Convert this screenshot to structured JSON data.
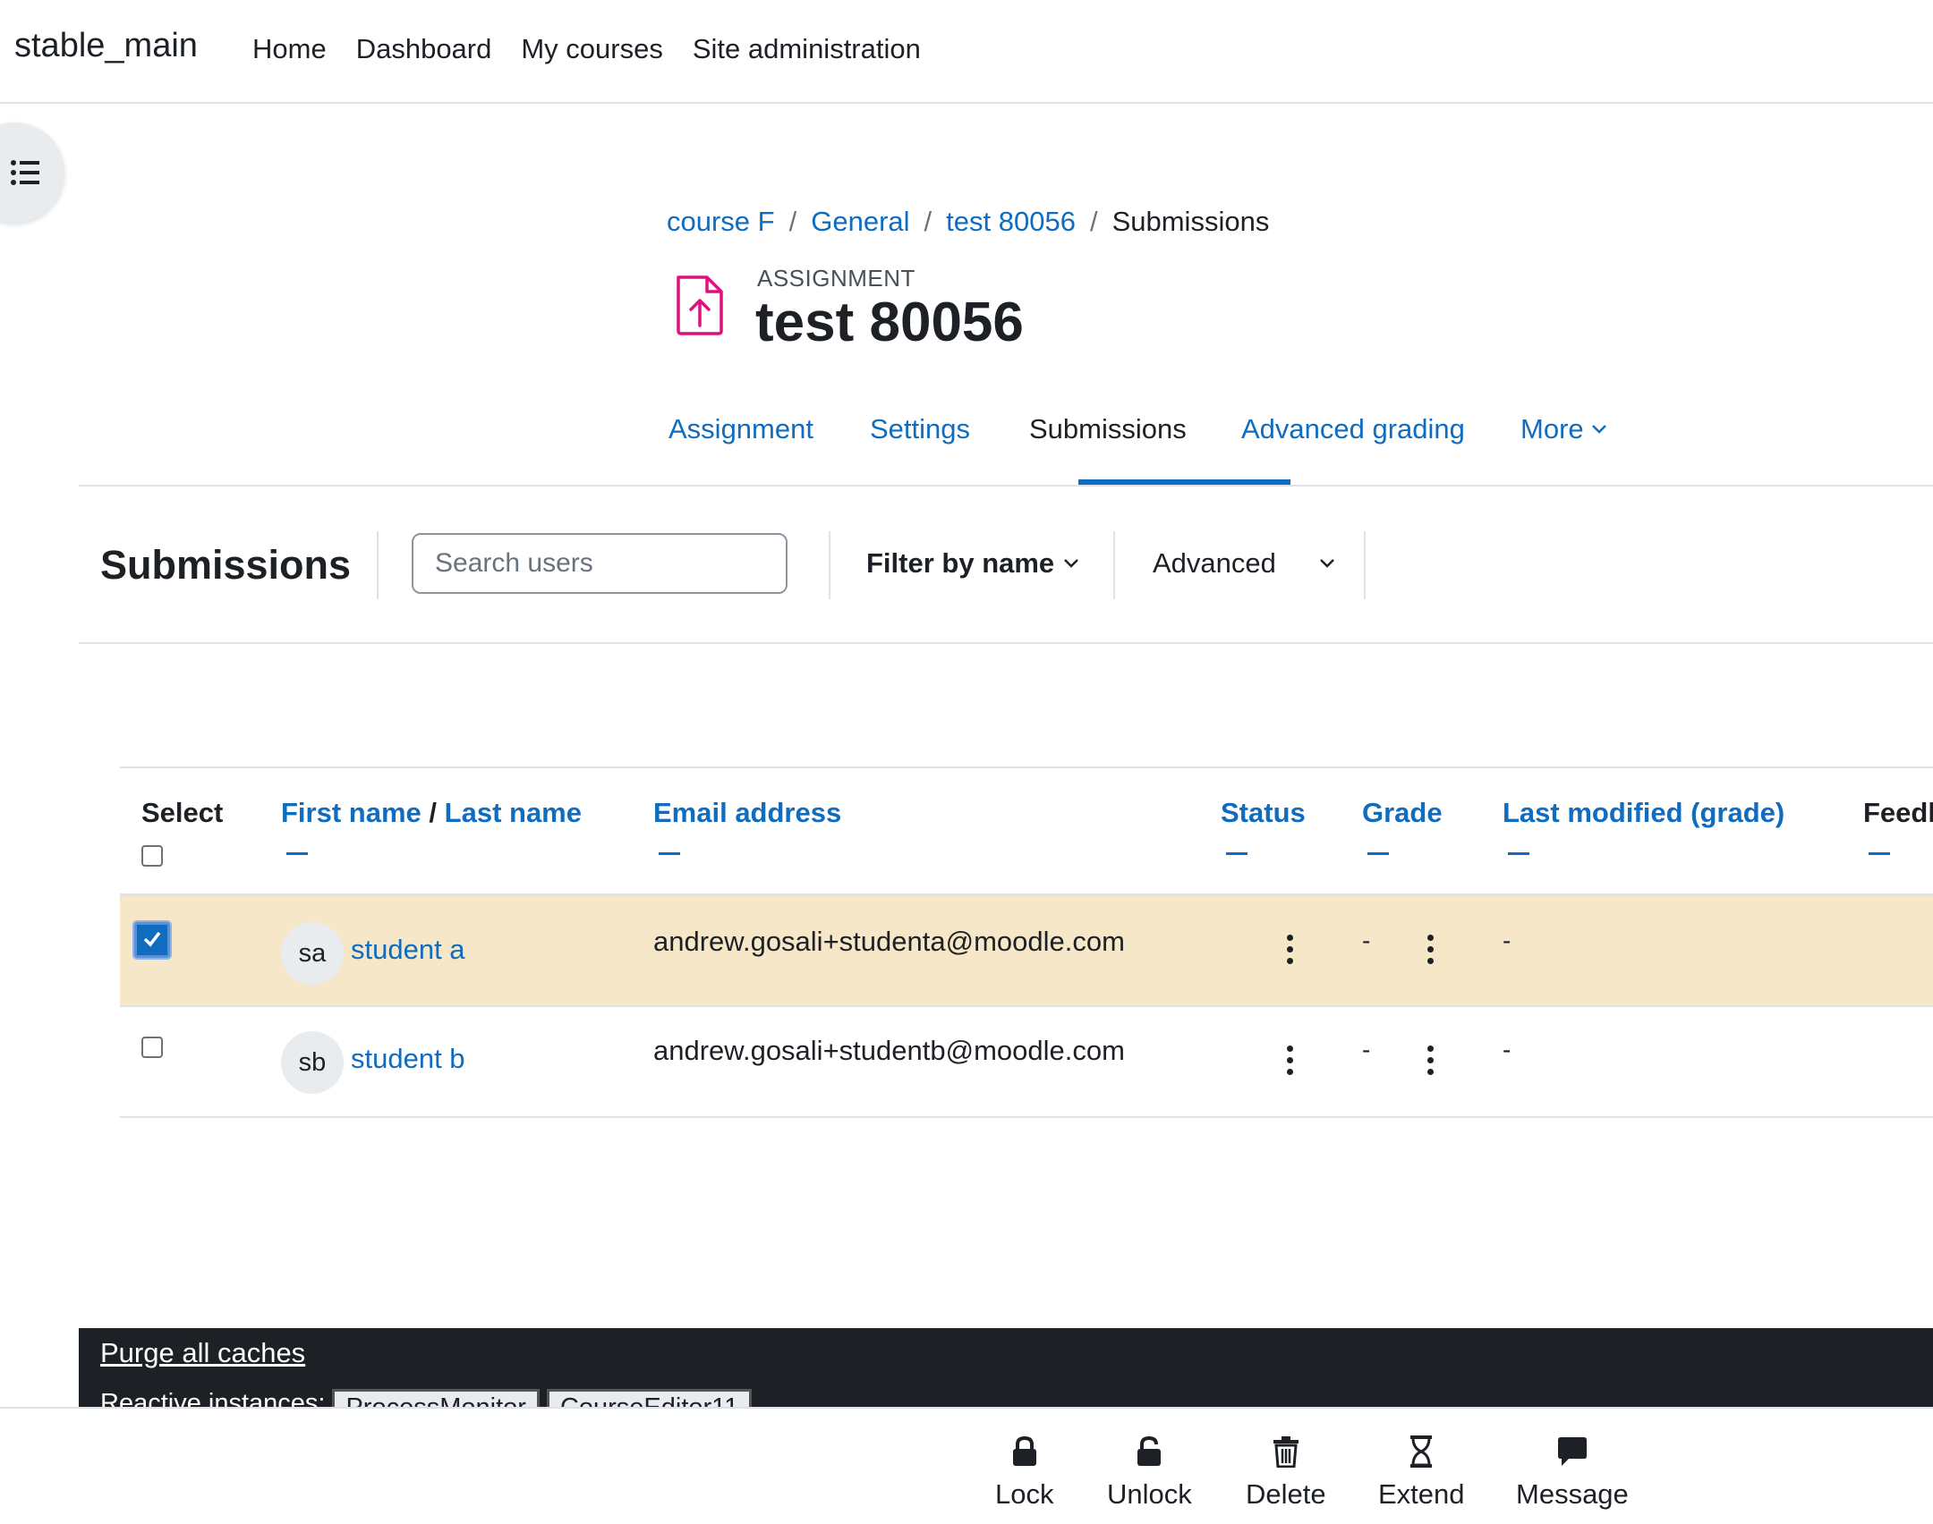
{
  "navbar": {
    "brand": "stable_main",
    "links": [
      "Home",
      "Dashboard",
      "My courses",
      "Site administration"
    ]
  },
  "breadcrumb": {
    "items": [
      "course F",
      "General",
      "test 80056"
    ],
    "current": "Submissions",
    "separator": "/"
  },
  "header": {
    "pretitle": "ASSIGNMENT",
    "title": "test 80056",
    "icon": "file-upload-icon"
  },
  "tabs": {
    "assignment": "Assignment",
    "settings": "Settings",
    "submissions": "Submissions",
    "advanced_grading": "Advanced grading",
    "more": "More",
    "active": "Submissions"
  },
  "toolbar": {
    "title": "Submissions",
    "search_placeholder": "Search users",
    "filter_label": "Filter by name",
    "advanced_label": "Advanced"
  },
  "table": {
    "headers": {
      "select": "Select",
      "first_name": "First name",
      "name_sep": "/",
      "last_name": "Last name",
      "email": "Email address",
      "status": "Status",
      "grade": "Grade",
      "last_modified": "Last modified (grade)",
      "feedback": "Feedl"
    },
    "rows": [
      {
        "initials": "sa",
        "name": "student a",
        "email": "andrew.gosali+studenta@moodle.com",
        "grade": "-",
        "last_modified": "-",
        "selected": true
      },
      {
        "initials": "sb",
        "name": "student b",
        "email": "andrew.gosali+studentb@moodle.com",
        "grade": "-",
        "last_modified": "-",
        "selected": false
      }
    ]
  },
  "footer": {
    "purge": "Purge all caches",
    "reactive_label": "Reactive instances:",
    "reactive_buttons": [
      "ProcessMonitor",
      "CourseEditor11"
    ]
  },
  "bulk_actions": {
    "lock": "Lock",
    "unlock": "Unlock",
    "delete": "Delete",
    "extend": "Extend",
    "message": "Message"
  },
  "colors": {
    "link": "#0f6cbf",
    "selected_row": "#f5e7c7",
    "footer_bg": "#1d2125",
    "assignment_icon": "#e0117f"
  }
}
